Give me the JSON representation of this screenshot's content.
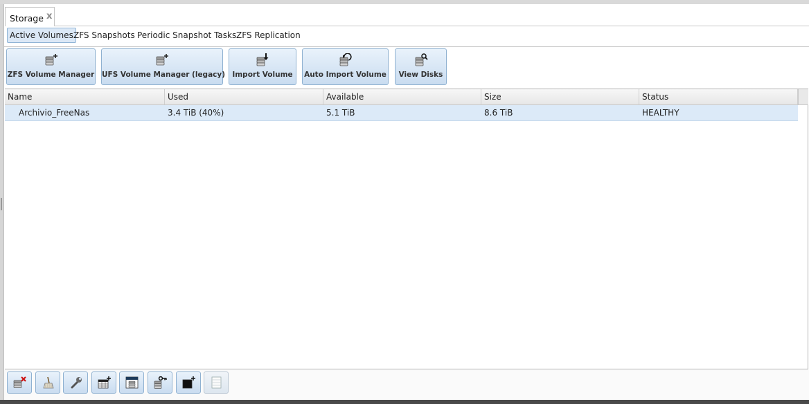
{
  "storage_tab": {
    "label": "Storage",
    "close_glyph": "x"
  },
  "sub_tabs": [
    {
      "label": "Active Volumes",
      "active": true
    },
    {
      "label": "ZFS Snapshots",
      "active": false
    },
    {
      "label": "Periodic Snapshot Tasks",
      "active": false
    },
    {
      "label": "ZFS Replication",
      "active": false
    }
  ],
  "toolbar": [
    {
      "label": "ZFS Volume Manager",
      "icon": "volume-add-icon"
    },
    {
      "label": "UFS Volume Manager (legacy)",
      "icon": "volume-add-icon"
    },
    {
      "label": "Import Volume",
      "icon": "volume-import-icon"
    },
    {
      "label": "Auto Import Volume",
      "icon": "volume-auto-import-icon"
    },
    {
      "label": "View Disks",
      "icon": "disk-search-icon"
    }
  ],
  "grid": {
    "columns": [
      "Name",
      "Used",
      "Available",
      "Size",
      "Status"
    ],
    "rows": [
      {
        "name": "Archivio_FreeNas",
        "used": "3.4 TiB (40%)",
        "available": "5.1 TiB",
        "size": "8.6 TiB",
        "status": "HEALTHY"
      }
    ]
  },
  "actions": [
    {
      "icon": "detach-volume-icon",
      "enabled": true
    },
    {
      "icon": "scrub-volume-icon",
      "enabled": true
    },
    {
      "icon": "edit-options-icon",
      "enabled": true
    },
    {
      "icon": "create-dataset-icon",
      "enabled": true
    },
    {
      "icon": "volume-status-icon",
      "enabled": true
    },
    {
      "icon": "change-permissions-icon",
      "enabled": true
    },
    {
      "icon": "create-zvol-icon",
      "enabled": true
    },
    {
      "icon": "blank-icon",
      "enabled": false
    }
  ],
  "colors": {
    "accent": "#dceaf8",
    "button_border": "#8fb1d1",
    "detach_red": "#cc1111"
  }
}
